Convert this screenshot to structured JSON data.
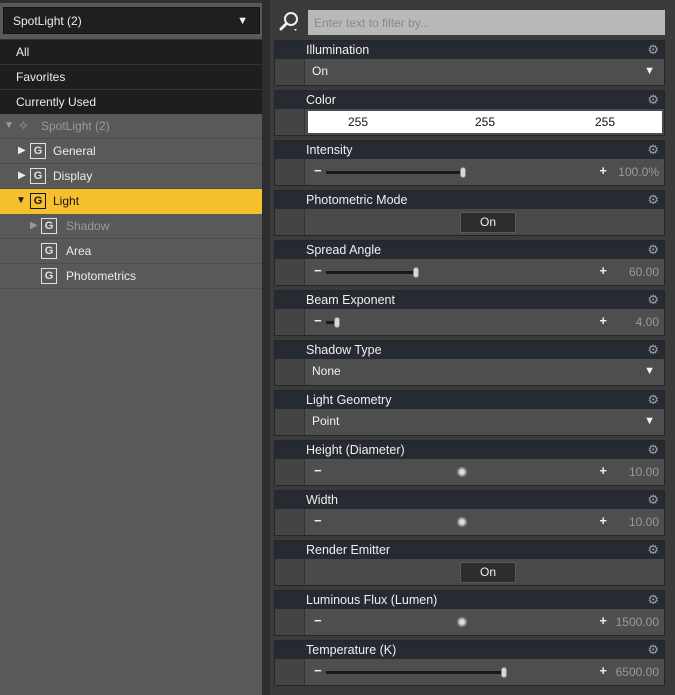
{
  "left": {
    "selector": {
      "label": "SpotLight (2)"
    },
    "categories": [
      "All",
      "Favorites",
      "Currently Used"
    ],
    "tree": {
      "root": "SpotLight (2)",
      "items": [
        {
          "label": "General",
          "level": 1,
          "state": "collapsed"
        },
        {
          "label": "Display",
          "level": 1,
          "state": "collapsed"
        },
        {
          "label": "Light",
          "level": 1,
          "state": "expanded",
          "selected": true
        },
        {
          "label": "Shadow",
          "level": 2,
          "state": "collapsed",
          "dimmed": true
        },
        {
          "label": "Area",
          "level": 2
        },
        {
          "label": "Photometrics",
          "level": 2
        }
      ]
    }
  },
  "search": {
    "placeholder": "Enter text to filter by..."
  },
  "properties": [
    {
      "name": "Illumination",
      "type": "dropdown",
      "value": "On"
    },
    {
      "name": "Color",
      "type": "color",
      "rgb": [
        "255",
        "255",
        "255"
      ]
    },
    {
      "name": "Intensity",
      "type": "slider",
      "value": "100.0%",
      "fraction": 0.5
    },
    {
      "name": "Photometric Mode",
      "type": "toggle",
      "value": "On"
    },
    {
      "name": "Spread Angle",
      "type": "slider",
      "value": "60.00",
      "fraction": 0.33
    },
    {
      "name": "Beam Exponent",
      "type": "slider",
      "value": "4.00",
      "fraction": 0.04
    },
    {
      "name": "Shadow Type",
      "type": "dropdown",
      "value": "None"
    },
    {
      "name": "Light Geometry",
      "type": "dropdown",
      "value": "Point"
    },
    {
      "name": "Height (Diameter)",
      "type": "slider",
      "value": "10.00",
      "fraction": 0.5
    },
    {
      "name": "Width",
      "type": "slider",
      "value": "10.00",
      "fraction": 0.5
    },
    {
      "name": "Render Emitter",
      "type": "toggle",
      "value": "On"
    },
    {
      "name": "Luminous Flux (Lumen)",
      "type": "slider",
      "value": "1500.00",
      "fraction": 0.5
    },
    {
      "name": "Temperature (K)",
      "type": "slider",
      "value": "6500.00",
      "fraction": 0.65
    }
  ],
  "icons": {
    "search": "search-icon",
    "gear": "gear-icon",
    "group": "group-icon",
    "spotlight": "spotlight-icon"
  },
  "colors": {
    "selection": "#f5c02b",
    "header": "#262a33",
    "panel": "#595959"
  }
}
